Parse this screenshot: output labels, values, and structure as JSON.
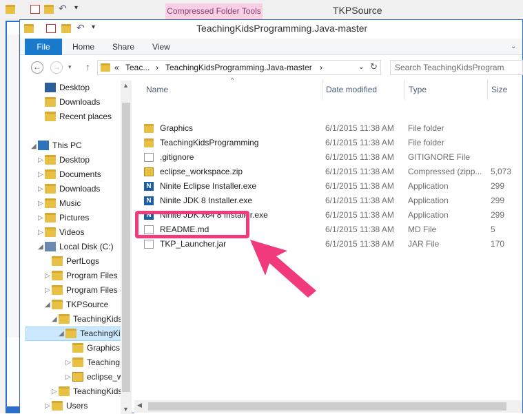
{
  "background_window": {
    "title": "TKPSource",
    "contextual_tab": "Compressed Folder Tools"
  },
  "window": {
    "title": "TeachingKidsProgramming.Java-master"
  },
  "ribbon": {
    "tabs": [
      "File",
      "Home",
      "Share",
      "View"
    ]
  },
  "address": {
    "segments": [
      "«",
      "Teac...",
      "›",
      "TeachingKidsProgramming.Java-master",
      "›"
    ],
    "search_placeholder": "Search TeachingKidsProgram..."
  },
  "nav": {
    "items": [
      {
        "label": "Desktop"
      },
      {
        "label": "Downloads"
      },
      {
        "label": "Recent places"
      },
      {
        "label": "This PC"
      },
      {
        "label": "Desktop"
      },
      {
        "label": "Documents"
      },
      {
        "label": "Downloads"
      },
      {
        "label": "Music"
      },
      {
        "label": "Pictures"
      },
      {
        "label": "Videos"
      },
      {
        "label": "Local Disk (C:)"
      },
      {
        "label": "PerfLogs"
      },
      {
        "label": "Program Files"
      },
      {
        "label": "Program Files ("
      },
      {
        "label": "TKPSource"
      },
      {
        "label": "TeachingKids"
      },
      {
        "label": "TeachingKi"
      },
      {
        "label": "Graphics"
      },
      {
        "label": "Teaching"
      },
      {
        "label": "eclipse_w"
      },
      {
        "label": "TeachingKids"
      },
      {
        "label": "Users"
      }
    ]
  },
  "columns": {
    "name": "Name",
    "date": "Date modified",
    "type": "Type",
    "size": "Size"
  },
  "files": [
    {
      "name": "Graphics",
      "date": "6/1/2015 11:38 AM",
      "type": "File folder",
      "size": ""
    },
    {
      "name": "TeachingKidsProgramming",
      "date": "6/1/2015 11:38 AM",
      "type": "File folder",
      "size": ""
    },
    {
      "name": ".gitignore",
      "date": "6/1/2015 11:38 AM",
      "type": "GITIGNORE File",
      "size": ""
    },
    {
      "name": "eclipse_workspace.zip",
      "date": "6/1/2015 11:38 AM",
      "type": "Compressed (zipp...",
      "size": "5,073"
    },
    {
      "name": "Ninite Eclipse Installer.exe",
      "date": "6/1/2015 11:38 AM",
      "type": "Application",
      "size": "299"
    },
    {
      "name": "Ninite JDK 8 Installer.exe",
      "date": "6/1/2015 11:38 AM",
      "type": "Application",
      "size": "299"
    },
    {
      "name": "Ninite JDK x64 8 Installer.exe",
      "date": "6/1/2015 11:38 AM",
      "type": "Application",
      "size": "299"
    },
    {
      "name": "README.md",
      "date": "6/1/2015 11:38 AM",
      "type": "MD File",
      "size": "5"
    },
    {
      "name": "TKP_Launcher.jar",
      "date": "6/1/2015 11:38 AM",
      "type": "JAR File",
      "size": "170"
    }
  ],
  "colors": {
    "accent": "#1979ca",
    "highlight": "#f03a7b",
    "contextual_tab_bg": "#f7d0e6"
  }
}
